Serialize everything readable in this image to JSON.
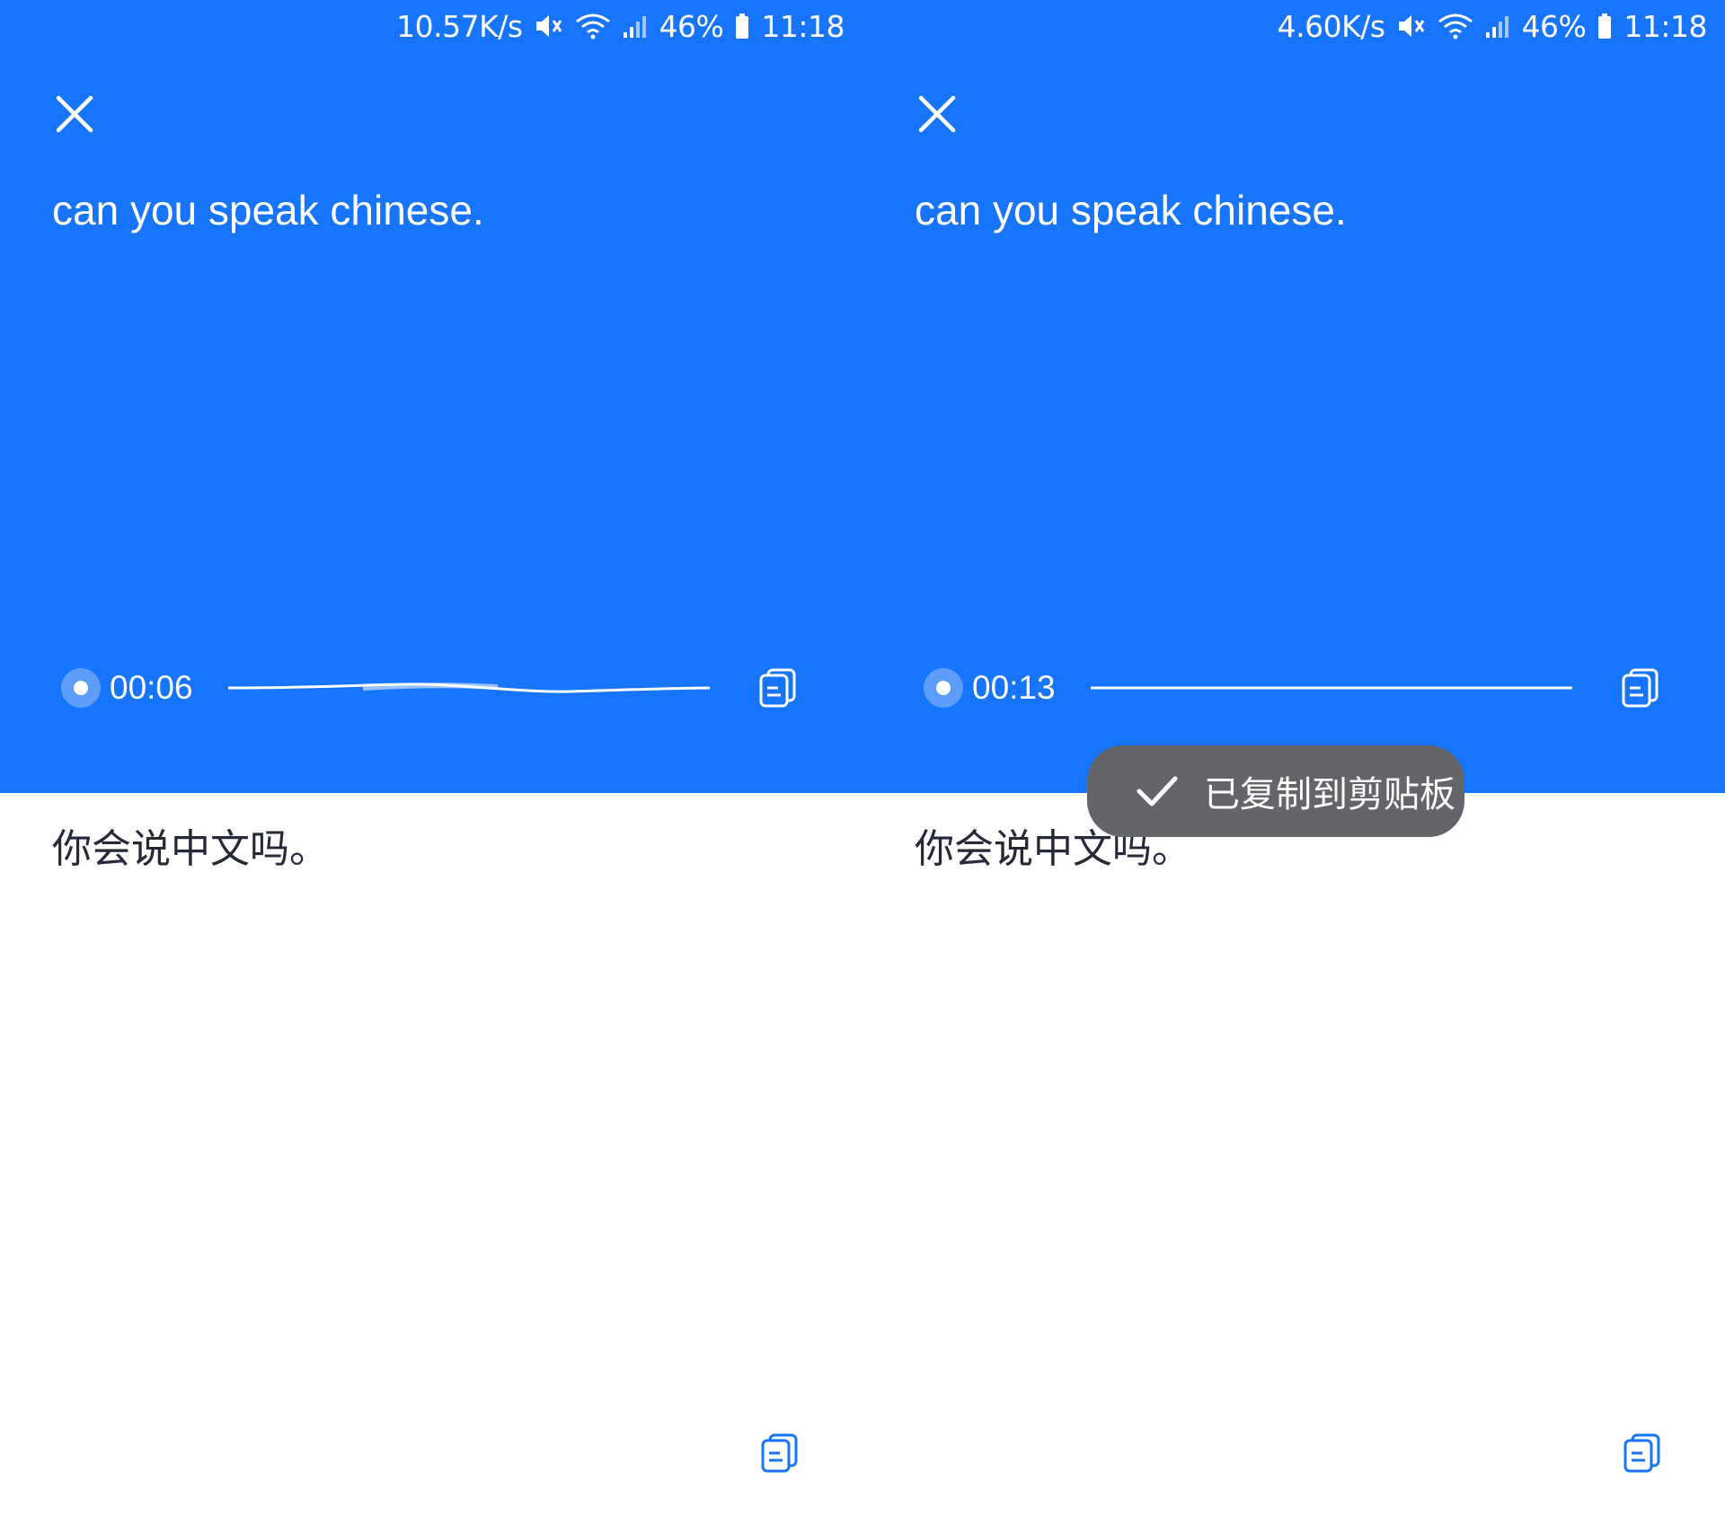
{
  "colors": {
    "accent_blue": "#1774fd",
    "toast_bg": "#646569",
    "body_text": "#262a38"
  },
  "screens": [
    {
      "status_bar": {
        "speed": "10.57K/s",
        "battery": "46%",
        "time": "11:18",
        "icons": [
          "mute-icon",
          "wifi-icon",
          "signal-icon",
          "battery-icon"
        ]
      },
      "close_icon": "close-icon",
      "source_text": "can you speak chinese.",
      "playback": {
        "time": "00:06",
        "state": "playing"
      },
      "target_text": "你会说中文吗。",
      "copy_icon": "copy-icon"
    },
    {
      "status_bar": {
        "speed": "4.60K/s",
        "battery": "46%",
        "time": "11:18",
        "icons": [
          "mute-icon",
          "wifi-icon",
          "signal-icon",
          "battery-icon"
        ]
      },
      "close_icon": "close-icon",
      "source_text": "can you speak chinese.",
      "playback": {
        "time": "00:13",
        "state": "stopped"
      },
      "target_text": "你会说中文吗。",
      "copy_icon": "copy-icon",
      "toast": {
        "icon": "check-icon",
        "message": "已复制到剪贴板"
      }
    }
  ]
}
